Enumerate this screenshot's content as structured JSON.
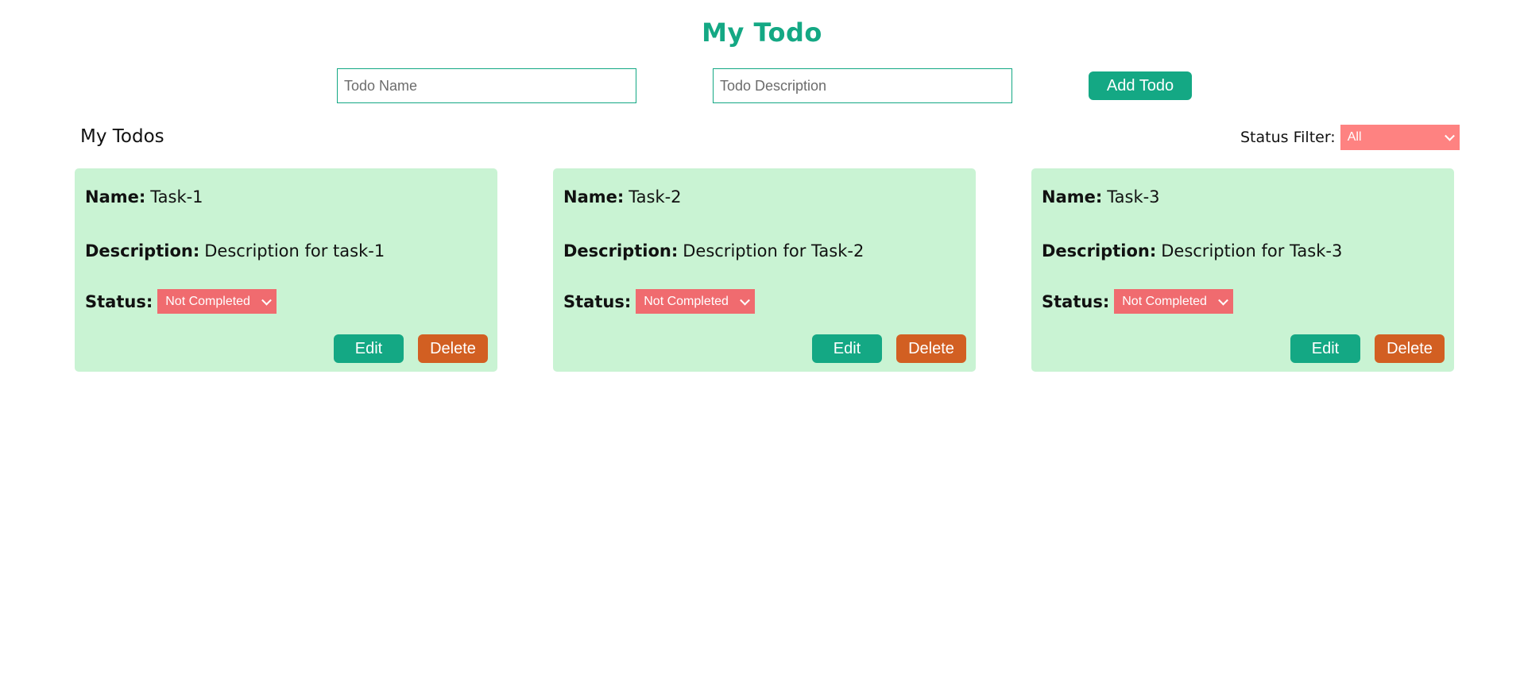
{
  "header": {
    "title": "My Todo"
  },
  "form": {
    "name_placeholder": "Todo Name",
    "description_placeholder": "Todo Description",
    "add_label": "Add Todo"
  },
  "list": {
    "title": "My Todos",
    "filter_label": "Status Filter:",
    "filter_value": "All",
    "todos": [
      {
        "name_label": "Name:",
        "name": "Task-1",
        "description_label": "Description:",
        "description": "Description for task-1",
        "status_label": "Status:",
        "status": "Not Completed",
        "edit_label": "Edit",
        "delete_label": "Delete"
      },
      {
        "name_label": "Name:",
        "name": "Task-2",
        "description_label": "Description:",
        "description": "Description for Task-2",
        "status_label": "Status:",
        "status": "Not Completed",
        "edit_label": "Edit",
        "delete_label": "Delete"
      },
      {
        "name_label": "Name:",
        "name": "Task-3",
        "description_label": "Description:",
        "description": "Description for Task-3",
        "status_label": "Status:",
        "status": "Not Completed",
        "edit_label": "Edit",
        "delete_label": "Delete"
      }
    ]
  },
  "colors": {
    "accent": "#14a884",
    "card_background": "#c9f3d3",
    "filter_select": "#fe8281",
    "status_select": "#f06b6f",
    "delete_button": "#d25f22"
  }
}
